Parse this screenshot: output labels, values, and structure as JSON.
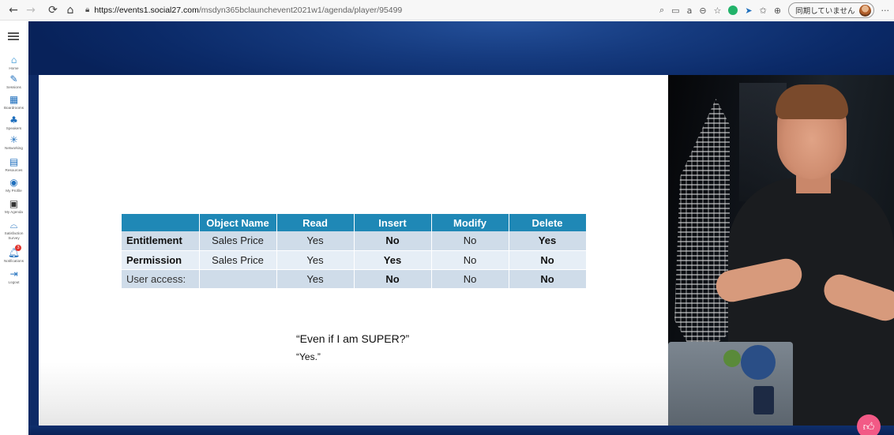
{
  "browser": {
    "url_host": "https://events1.social27.com",
    "url_path": "/msdyn365bclaunchevent2021w1/agenda/player/95499",
    "sync_status": "同期していません"
  },
  "sidebar": {
    "items": [
      {
        "label": "Home",
        "icon": "home-icon"
      },
      {
        "label": "Sessions",
        "icon": "pencil-icon"
      },
      {
        "label": "Boardrooms",
        "icon": "boardroom-icon"
      },
      {
        "label": "Speakers",
        "icon": "speaker-icon"
      },
      {
        "label": "Networking",
        "icon": "networking-icon"
      },
      {
        "label": "Resources",
        "icon": "resources-icon"
      },
      {
        "label": "My Profile",
        "icon": "profile-icon"
      },
      {
        "label": "My Agenda",
        "icon": "calendar-icon"
      },
      {
        "label": "Satisfaction Survey",
        "icon": "survey-icon"
      },
      {
        "label": "Notifications",
        "icon": "bell-icon",
        "badge": "3"
      },
      {
        "label": "Logout",
        "icon": "logout-icon"
      }
    ]
  },
  "slide": {
    "table": {
      "headers": [
        "",
        "Object Name",
        "Read",
        "Insert",
        "Modify",
        "Delete"
      ],
      "rows": [
        {
          "head": "Entitlement",
          "cells": [
            "Sales Price",
            "Yes",
            "No",
            "No",
            "Yes"
          ]
        },
        {
          "head": "Permission",
          "cells": [
            "Sales Price",
            "Yes",
            "Yes",
            "No",
            "No"
          ]
        },
        {
          "head": "User access:",
          "cells": [
            "",
            "Yes",
            "No",
            "No",
            "No"
          ]
        }
      ]
    },
    "quote_question": "“Even if I am SUPER?”",
    "quote_answer": "“Yes.”"
  },
  "colors": {
    "header_blue": "#1f88b6",
    "banner_navy": "#0b2a68",
    "like_pink": "#f25a86"
  }
}
